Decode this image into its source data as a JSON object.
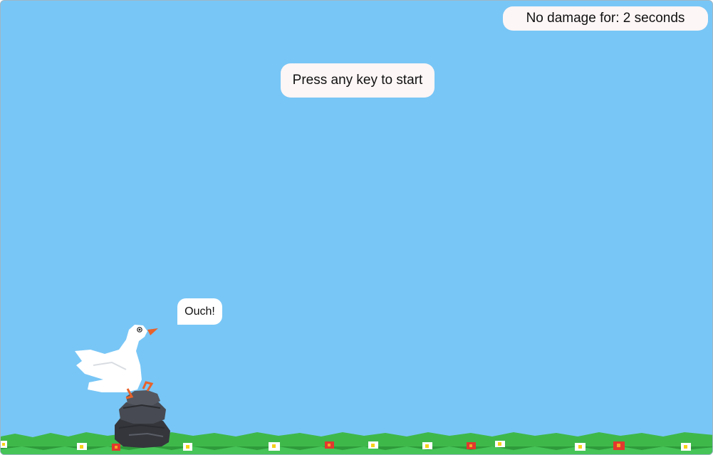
{
  "hud": {
    "damage_timer_text": "No damage for: 2 seconds"
  },
  "prompt": {
    "start_text": "Press any key to start"
  },
  "player": {
    "speech_text": "Ouch!",
    "character": "goose-icon"
  },
  "scene": {
    "sky_color": "#78c6f6",
    "grass_color": "#3fb84a",
    "rock_color": "#3f4148"
  }
}
